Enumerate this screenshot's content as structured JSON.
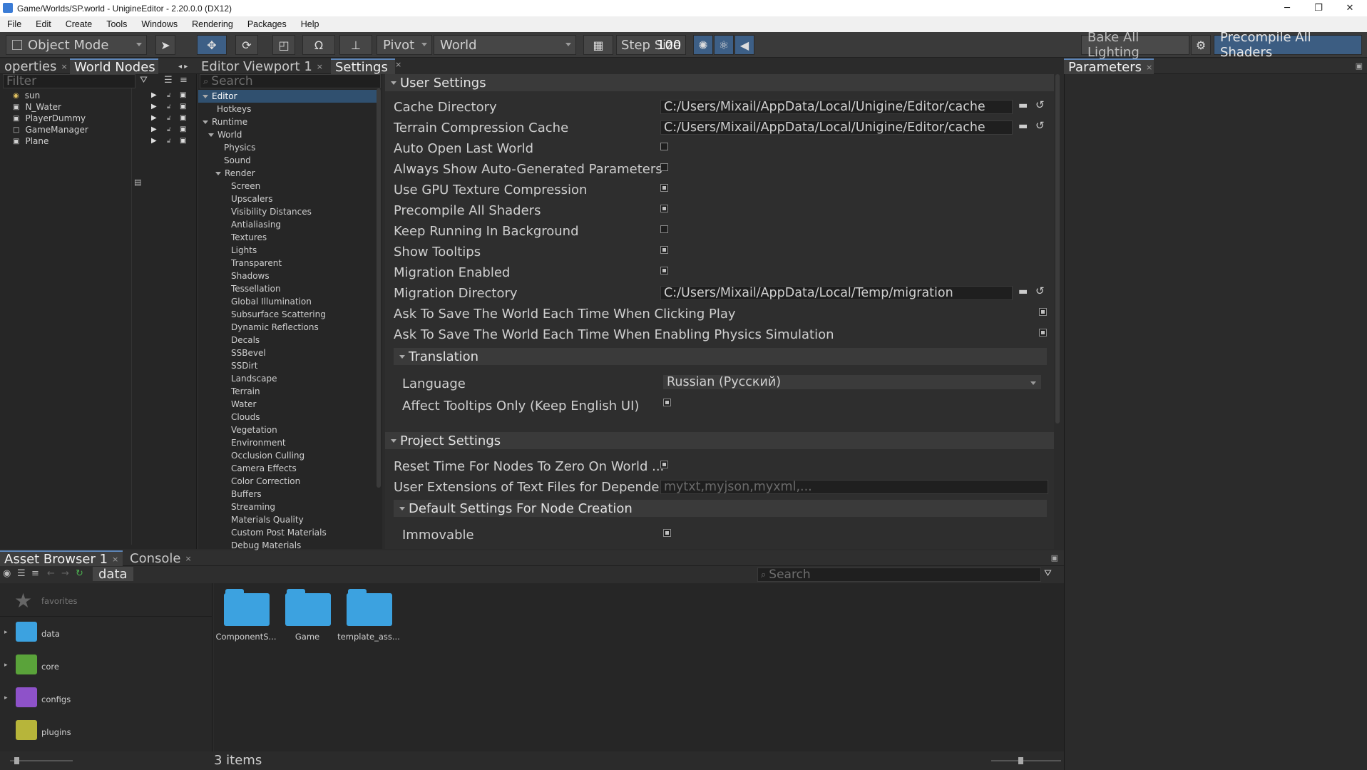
{
  "window": {
    "title": "Game/Worlds/SP.world - UnigineEditor - 2.20.0.0 (DX12)",
    "minimize": "─",
    "maximize": "❐",
    "close": "✕"
  },
  "menu": [
    "File",
    "Edit",
    "Create",
    "Tools",
    "Windows",
    "Rendering",
    "Packages",
    "Help"
  ],
  "toolbar": {
    "mode": "Object Mode",
    "pivot": "Pivot",
    "space": "World",
    "step": "Step Size",
    "step_value": "100",
    "bake": "Bake All Lighting",
    "precompile": "Precompile All Shaders"
  },
  "left_tabs": [
    "operties",
    "World Nodes"
  ],
  "left_filter_placeholder": "Filter",
  "nodes": [
    {
      "name": "sun"
    },
    {
      "name": "N_Water"
    },
    {
      "name": "PlayerDummy"
    },
    {
      "name": "GameManager"
    },
    {
      "name": "Plane"
    }
  ],
  "center_tabs": [
    "Editor Viewport 1",
    "Settings"
  ],
  "settings_search_placeholder": "Search",
  "settings_tree": {
    "editor": "Editor",
    "hotkeys": "Hotkeys",
    "runtime": "Runtime",
    "world": "World",
    "physics": "Physics",
    "sound": "Sound",
    "render": "Render",
    "render_children": [
      "Screen",
      "Upscalers",
      "Visibility Distances",
      "Antialiasing",
      "Textures",
      "Lights",
      "Transparent",
      "Shadows",
      "Tessellation",
      "Global Illumination",
      "Subsurface Scattering",
      "Dynamic Reflections",
      "Decals",
      "SSBevel",
      "SSDirt",
      "Landscape",
      "Terrain",
      "Water",
      "Clouds",
      "Vegetation",
      "Environment",
      "Occlusion Culling",
      "Camera Effects",
      "Color Correction",
      "Buffers",
      "Streaming",
      "Materials Quality",
      "Custom Post Materials",
      "Debug Materials"
    ]
  },
  "settings": {
    "user_settings": "User Settings",
    "cache_dir_label": "Cache Directory",
    "cache_dir_value": "C:/Users/Mixail/AppData/Local/Unigine/Editor/cache",
    "terrain_cache_label": "Terrain Compression Cache",
    "terrain_cache_value": "C:/Users/Mixail/AppData/Local/Unigine/Editor/cache",
    "auto_open": "Auto Open Last World",
    "always_show": "Always Show Auto-Generated Parameters",
    "gpu_tex": "Use GPU Texture Compression",
    "precompile": "Precompile All Shaders",
    "keep_running": "Keep Running In Background",
    "tooltips": "Show Tooltips",
    "migration_enabled": "Migration Enabled",
    "migration_dir_label": "Migration Directory",
    "migration_dir_value": "C:/Users/Mixail/AppData/Local/Temp/migration",
    "ask_save_play": "Ask To Save The World Each Time When Clicking Play",
    "ask_save_physics": "Ask To Save The World Each Time When Enabling Physics Simulation",
    "translation": "Translation",
    "language_label": "Language",
    "language_value": "Russian (Русский)",
    "affect_tooltips": "Affect Tooltips Only (Keep English UI)",
    "project_settings": "Project Settings",
    "reset_time": "Reset Time For Nodes To Zero On World ...",
    "user_ext_label": "User Extensions of Text Files for Depende...",
    "user_ext_placeholder": "mytxt,myjson,myxml,...",
    "default_settings": "Default Settings For Node Creation",
    "immovable": "Immovable"
  },
  "right_tab": "Parameters",
  "bottom_tabs": [
    "Asset Browser 1",
    "Console"
  ],
  "asset_path": "data",
  "asset_search_placeholder": "Search",
  "asset_left": [
    "favorites",
    "data",
    "core",
    "configs",
    "plugins"
  ],
  "asset_items": [
    "ComponentS...",
    "Game",
    "template_ass..."
  ],
  "asset_count": "3 items",
  "colors": {
    "accent": "#5e86b8",
    "folder": "#3ca2e0",
    "blue_button": "#3c5d82"
  }
}
